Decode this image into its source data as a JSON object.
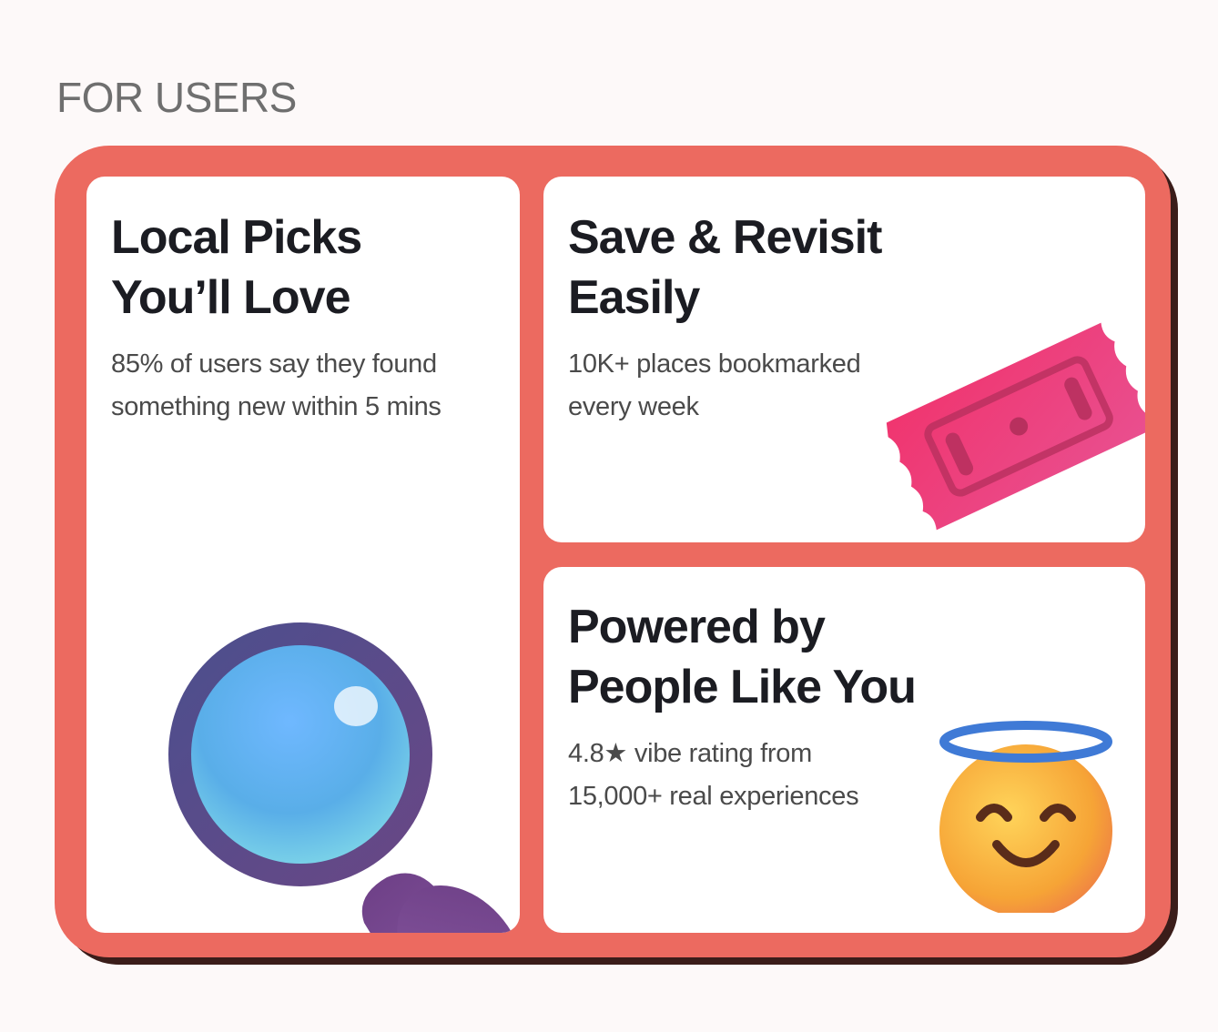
{
  "section": {
    "label": "FOR USERS"
  },
  "cards": [
    {
      "title_line1": "Local Picks",
      "title_line2": "You’ll Love",
      "desc_line1": "85% of users say they found",
      "desc_line2": "something new within 5 mins",
      "illustration": "magnifying-glass-icon"
    },
    {
      "title_line1": "Save & Revisit",
      "title_line2": "Easily",
      "desc_line1": "10K+ places bookmarked",
      "desc_line2": "every week",
      "illustration": "ticket-icon"
    },
    {
      "title_line1": "Powered by",
      "title_line2": "People Like You",
      "desc_line1": "4.8★ vibe rating from",
      "desc_line2": "15,000+ real experiences",
      "illustration": "smiling-halo-face-icon"
    }
  ],
  "colors": {
    "frame": "#ec6a60",
    "frame_shadow": "#3b1d1a",
    "card_bg": "#ffffff",
    "title": "#1b1c22",
    "body_text": "#4a4a4a",
    "label": "#6f6f6f"
  }
}
